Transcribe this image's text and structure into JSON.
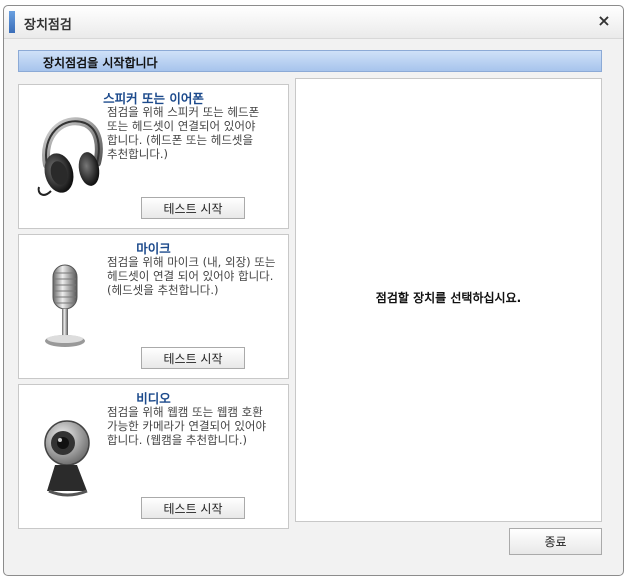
{
  "window": {
    "title": "장치점검",
    "close_glyph": "×"
  },
  "header": {
    "label": "장치점검을 시작합니다"
  },
  "devices": [
    {
      "title": "스피커 또는 이어폰",
      "description": "점검을 위해 스피커 또는 헤드폰 또는 헤드셋이 연결되어 있어야 합니다. (헤드폰 또는 헤드셋을 추천합니다.)",
      "button": "테스트 시작",
      "icon": "headphones-icon"
    },
    {
      "title": "마이크",
      "description": "점검을 위해 마이크 (내, 외장) 또는 헤드셋이 연결 되어 있어야 합니다. (헤드셋을 추천합니다.)",
      "button": "테스트 시작",
      "icon": "microphone-icon"
    },
    {
      "title": "비디오",
      "description": "점검을 위해 웹캠 또는 웹캠 호환 가능한 카메라가 연결되어 있어야 합니다. (웹캠을 추천합니다.)",
      "button": "테스트 시작",
      "icon": "webcam-icon"
    }
  ],
  "result": {
    "message": "점검할 장치를 선택하십시요."
  },
  "footer": {
    "exit_label": "종료"
  }
}
